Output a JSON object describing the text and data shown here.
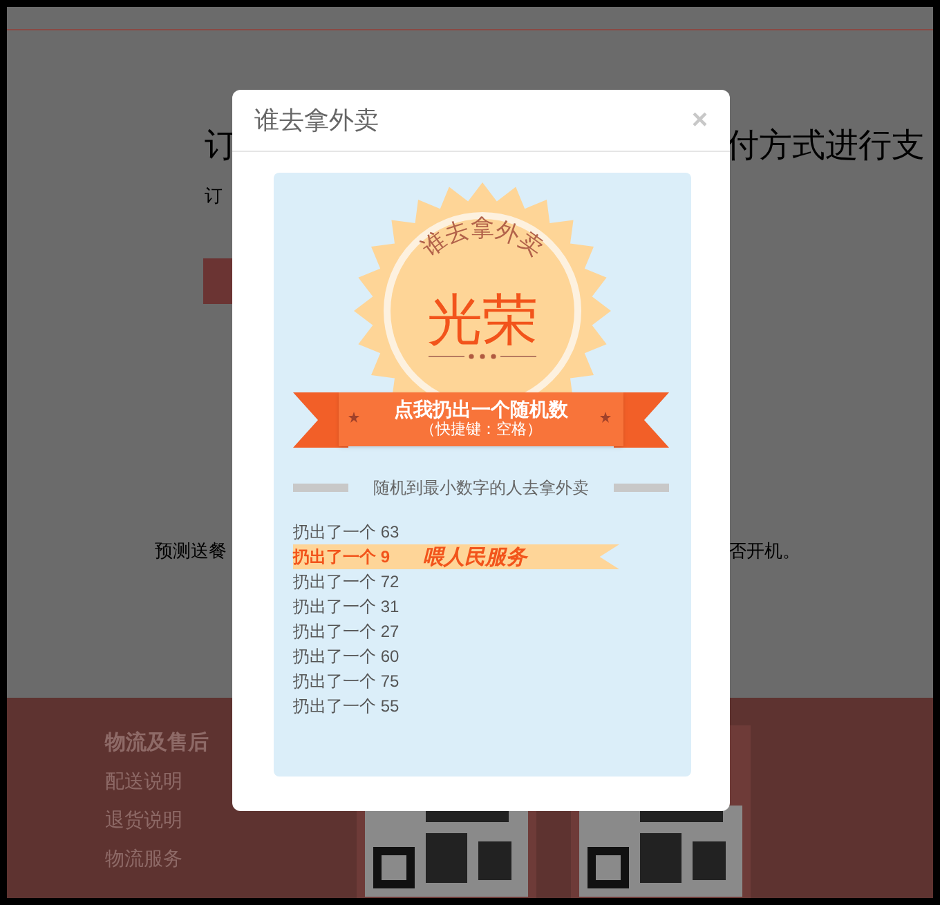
{
  "background_page": {
    "heading_left": "订",
    "heading_right": "付方式进行支",
    "subtext": "订",
    "notice_left": "预测送餐",
    "notice_right": "否开机。",
    "footer": {
      "heading": "物流及售后",
      "links": [
        "配送说明",
        "退货说明",
        "物流服务"
      ]
    }
  },
  "dialog": {
    "title": "谁去拿外卖",
    "close": "×",
    "seal": {
      "arc_text": "谁去拿外卖",
      "title": "光荣"
    },
    "roll_button": {
      "label": "点我扔出一个随机数",
      "hint": "（快捷键：空格）"
    },
    "rule": "随机到最小数字的人去拿外卖",
    "rolls": [
      {
        "text": "扔出了一个 63",
        "selected": false
      },
      {
        "text": "扔出了一个 9",
        "selected": true,
        "tag": "喂人民服务"
      },
      {
        "text": "扔出了一个 72",
        "selected": false
      },
      {
        "text": "扔出了一个 31",
        "selected": false
      },
      {
        "text": "扔出了一个 27",
        "selected": false
      },
      {
        "text": "扔出了一个 60",
        "selected": false
      },
      {
        "text": "扔出了一个 75",
        "selected": false
      },
      {
        "text": "扔出了一个 55",
        "selected": false
      }
    ]
  }
}
